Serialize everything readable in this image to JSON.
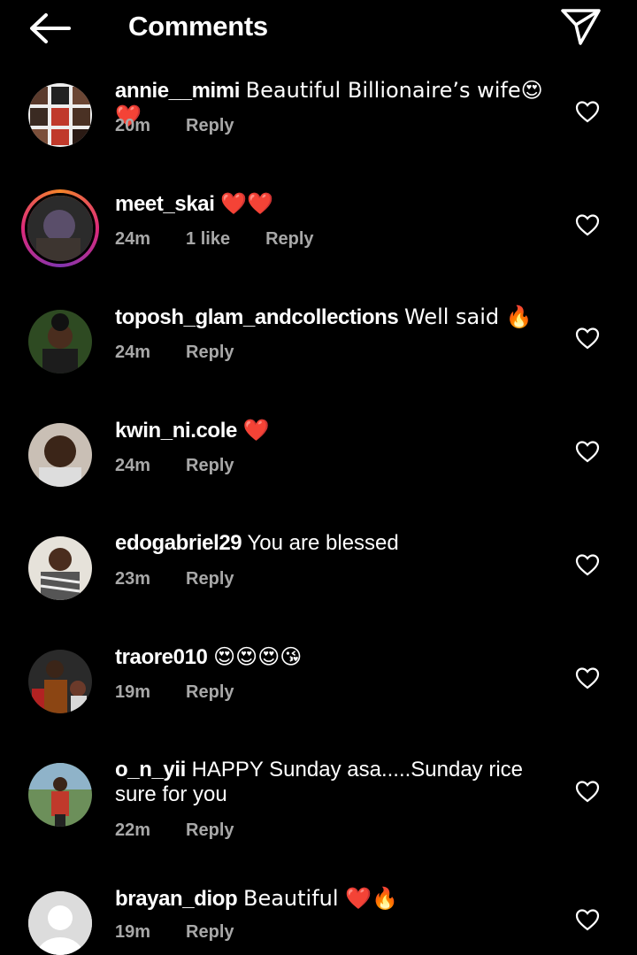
{
  "header": {
    "title": "Comments",
    "back_icon": "arrow-left-icon",
    "share_icon": "paper-plane-icon"
  },
  "comments": [
    {
      "username": "annie__mimi",
      "text": "Beautiful Billionaire’s wife😍❤️",
      "time": "20m",
      "likes": "",
      "reply": "Reply"
    },
    {
      "username": "meet_skai",
      "text": "❤️❤️",
      "time": "24m",
      "likes": "1 like",
      "reply": "Reply"
    },
    {
      "username": "toposh_glam_andcollections",
      "text": "Well said 🔥",
      "time": "24m",
      "likes": "",
      "reply": "Reply"
    },
    {
      "username": "kwin_ni.cole",
      "text": "❤️",
      "time": "24m",
      "likes": "",
      "reply": "Reply"
    },
    {
      "username": "edogabriel29",
      "text": "You are blessed",
      "time": "23m",
      "likes": "",
      "reply": "Reply"
    },
    {
      "username": "traore010",
      "text": "😍😍😍😘",
      "time": "19m",
      "likes": "",
      "reply": "Reply"
    },
    {
      "username": "o_n_yii",
      "text": "HAPPY Sunday asa.....Sunday rice sure for you",
      "time": "22m",
      "likes": "",
      "reply": "Reply"
    },
    {
      "username": "brayan_diop",
      "text": "Beautiful ❤️🔥",
      "time": "19m",
      "likes": "",
      "reply": "Reply"
    }
  ],
  "colors": {
    "background": "#000000",
    "text": "#ffffff",
    "meta": "#a8a8a8"
  }
}
